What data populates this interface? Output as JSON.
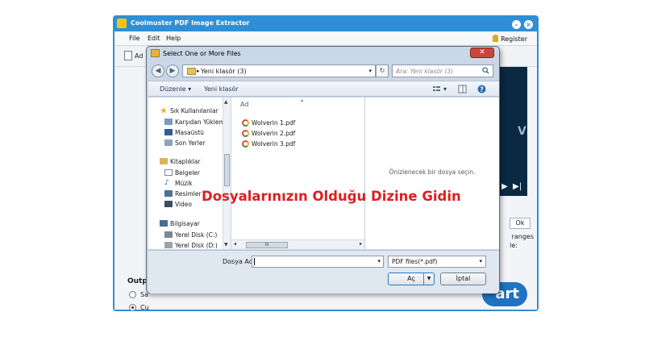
{
  "app": {
    "title": "Coolmuster PDF Image Extractor",
    "menu": [
      "File",
      "Edit",
      "Help"
    ],
    "register_label": "Register",
    "toolbar_add_label": "Ad",
    "ranges_label": "ranges",
    "ranges_sub": "le:",
    "page_field_value": "Ok",
    "output_label": "Outpu",
    "radio_1": "Sa",
    "radio_2": "Cu",
    "start_label": "art",
    "panel_letter": "V",
    "accent_color": "#2f8fd6"
  },
  "dialog": {
    "title": "Select One or More Files",
    "address": "Yeni klasör (3)",
    "search_placeholder": "Ara: Yeni klasör (3)",
    "commands": {
      "organize": "Düzenle ▾",
      "new_folder": "Yeni klasör"
    },
    "nav": {
      "favorites": "Sık Kullanılanlar",
      "downloads": "Karşıdan Yüklem",
      "desktop": "Masaüstü",
      "recent": "Son Yerler",
      "libraries": "Kitaplıklar",
      "documents": "Belgeler",
      "music": "Müzik",
      "pictures": "Resimler",
      "video": "Video",
      "computer": "Bilgisayar",
      "disk_c": "Yerel Disk (C:)",
      "disk_d": "Yerel Disk (D:)"
    },
    "column_header": "Ad",
    "files": [
      "Wolverin 1.pdf",
      "Wolverin 2.pdf",
      "Wolverin 3.pdf"
    ],
    "preview_text": "Önizlenecek bir dosya seçin.",
    "filename_label": "Dosya Adı:",
    "filename_value": "",
    "filter": "PDF files(*.pdf)",
    "open_button": "Aç",
    "cancel_button": "İptal",
    "scroll_grip": "III"
  },
  "caption": "Dosyalarınızın Olduğu Dizine Gidin"
}
